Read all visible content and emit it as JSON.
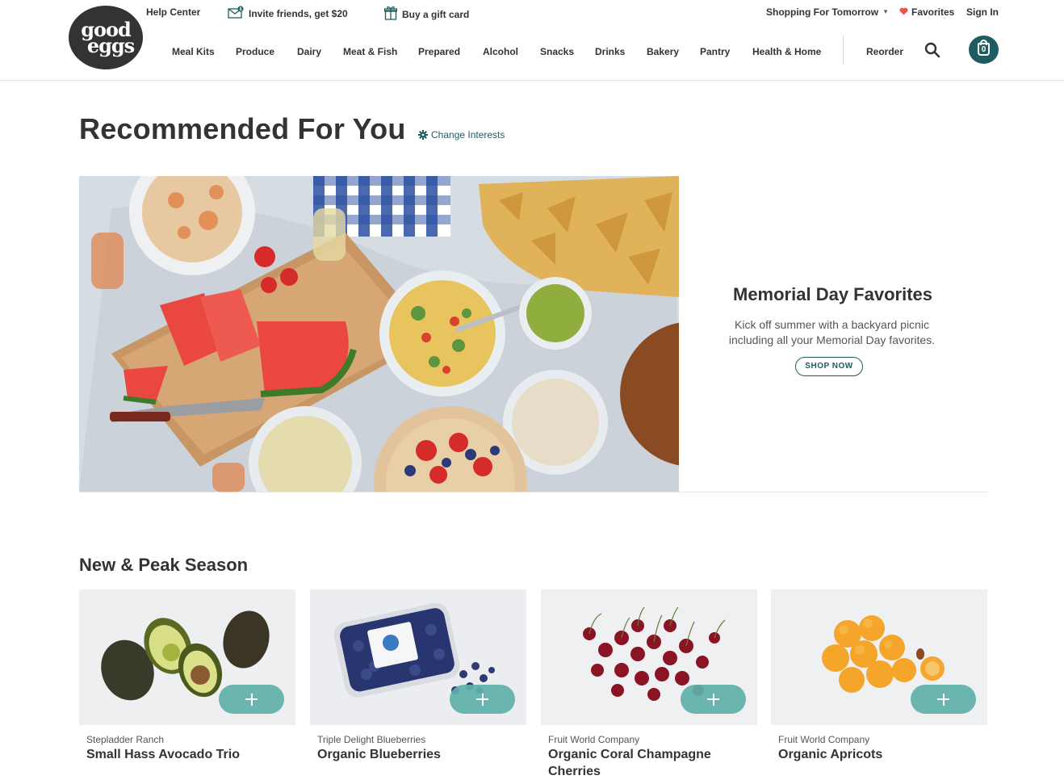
{
  "header": {
    "logo_line1": "good",
    "logo_line2": "eggs",
    "utility": {
      "help": "Help Center",
      "invite": "Invite friends, get $20",
      "gift": "Buy a gift card",
      "shopping_for": "Shopping For Tomorrow",
      "favorites": "Favorites",
      "sign_in": "Sign In"
    },
    "nav": [
      "Meal Kits",
      "Produce",
      "Dairy",
      "Meat & Fish",
      "Prepared",
      "Alcohol",
      "Snacks",
      "Drinks",
      "Bakery",
      "Pantry",
      "Health & Home"
    ],
    "reorder": "Reorder",
    "cart_count": "0"
  },
  "page": {
    "title": "Recommended For You",
    "change_interests": "Change Interests"
  },
  "hero": {
    "title": "Memorial Day Favorites",
    "text": "Kick off summer with a backyard picnic including all your Memorial Day favorites.",
    "cta": "SHOP NOW"
  },
  "section": {
    "title": "New & Peak Season",
    "products": [
      {
        "vendor": "Stepladder Ranch",
        "name": "Small Hass Avocado Trio"
      },
      {
        "vendor": "Triple Delight Blueberries",
        "name": "Organic Blueberries"
      },
      {
        "vendor": "Fruit World Company",
        "name": "Organic Coral Champagne Cherries"
      },
      {
        "vendor": "Fruit World Company",
        "name": "Organic Apricots"
      }
    ]
  },
  "colors": {
    "brand_teal": "#1f5c61",
    "add_button": "#60b0aa",
    "heart": "#e8574a"
  }
}
